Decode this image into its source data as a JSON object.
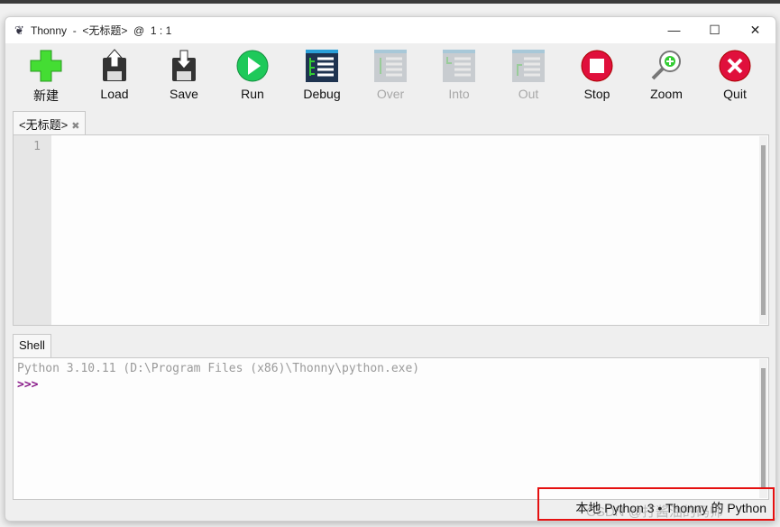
{
  "window": {
    "app_name": "Thonny",
    "title": "Thonny  -  <无标题>  @  1 : 1",
    "controls": {
      "minimize": "—",
      "maximize": "☐",
      "close": "✕"
    }
  },
  "toolbar": [
    {
      "label": "新建",
      "icon": "new-file-icon",
      "enabled": true
    },
    {
      "label": "Load",
      "icon": "load-icon",
      "enabled": true
    },
    {
      "label": "Save",
      "icon": "save-icon",
      "enabled": true
    },
    {
      "label": "Run",
      "icon": "run-icon",
      "enabled": true
    },
    {
      "label": "Debug",
      "icon": "debug-icon",
      "enabled": true
    },
    {
      "label": "Over",
      "icon": "step-over-icon",
      "enabled": false
    },
    {
      "label": "Into",
      "icon": "step-into-icon",
      "enabled": false
    },
    {
      "label": "Out",
      "icon": "step-out-icon",
      "enabled": false
    },
    {
      "label": "Stop",
      "icon": "stop-icon",
      "enabled": true
    },
    {
      "label": "Zoom",
      "icon": "zoom-icon",
      "enabled": true
    },
    {
      "label": "Quit",
      "icon": "quit-icon",
      "enabled": true
    }
  ],
  "editor": {
    "tab_label": "<无标题>",
    "tab_close": "✖",
    "line_numbers": [
      "1"
    ]
  },
  "shell": {
    "tab_label": "Shell",
    "info": "Python 3.10.11 (D:\\Program Files (x86)\\Thonny\\python.exe)",
    "prompt": ">>>"
  },
  "status": {
    "interpreter": "本地 Python 3 • Thonny 的 Python"
  },
  "watermark": "CSDN @打酱油的码师",
  "colors": {
    "highlight_box": "#e51010",
    "prompt": "#8a1c8a"
  }
}
